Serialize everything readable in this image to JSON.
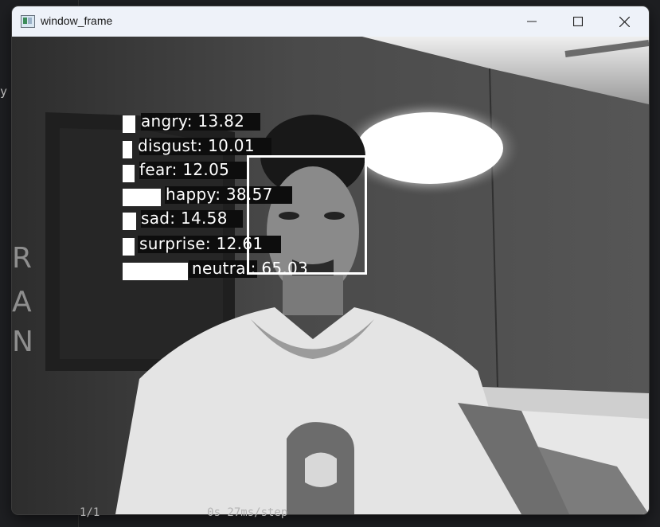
{
  "background": {
    "left_char": "y",
    "terminal_line": "1/1                0s 27ms/step"
  },
  "window": {
    "title": "window_frame",
    "icons": {
      "app": "app-icon",
      "minimize": "minimize-icon",
      "maximize": "maximize-icon",
      "close": "close-icon"
    }
  },
  "emotions": [
    {
      "label": "angry: 13.82",
      "score": 13.82
    },
    {
      "label": "disgust: 10.01",
      "score": 10.01
    },
    {
      "label": "fear: 12.05",
      "score": 12.05
    },
    {
      "label": "happy: 38.57",
      "score": 38.57
    },
    {
      "label": "sad: 14.58",
      "score": 14.58
    },
    {
      "label": "surprise: 12.61",
      "score": 12.61
    },
    {
      "label": "neutral: 65.03",
      "score": 65.03
    }
  ],
  "colors": {
    "titlebar": "#eef2f9",
    "bar": "#ffffff",
    "face_box": "#ffffff"
  }
}
